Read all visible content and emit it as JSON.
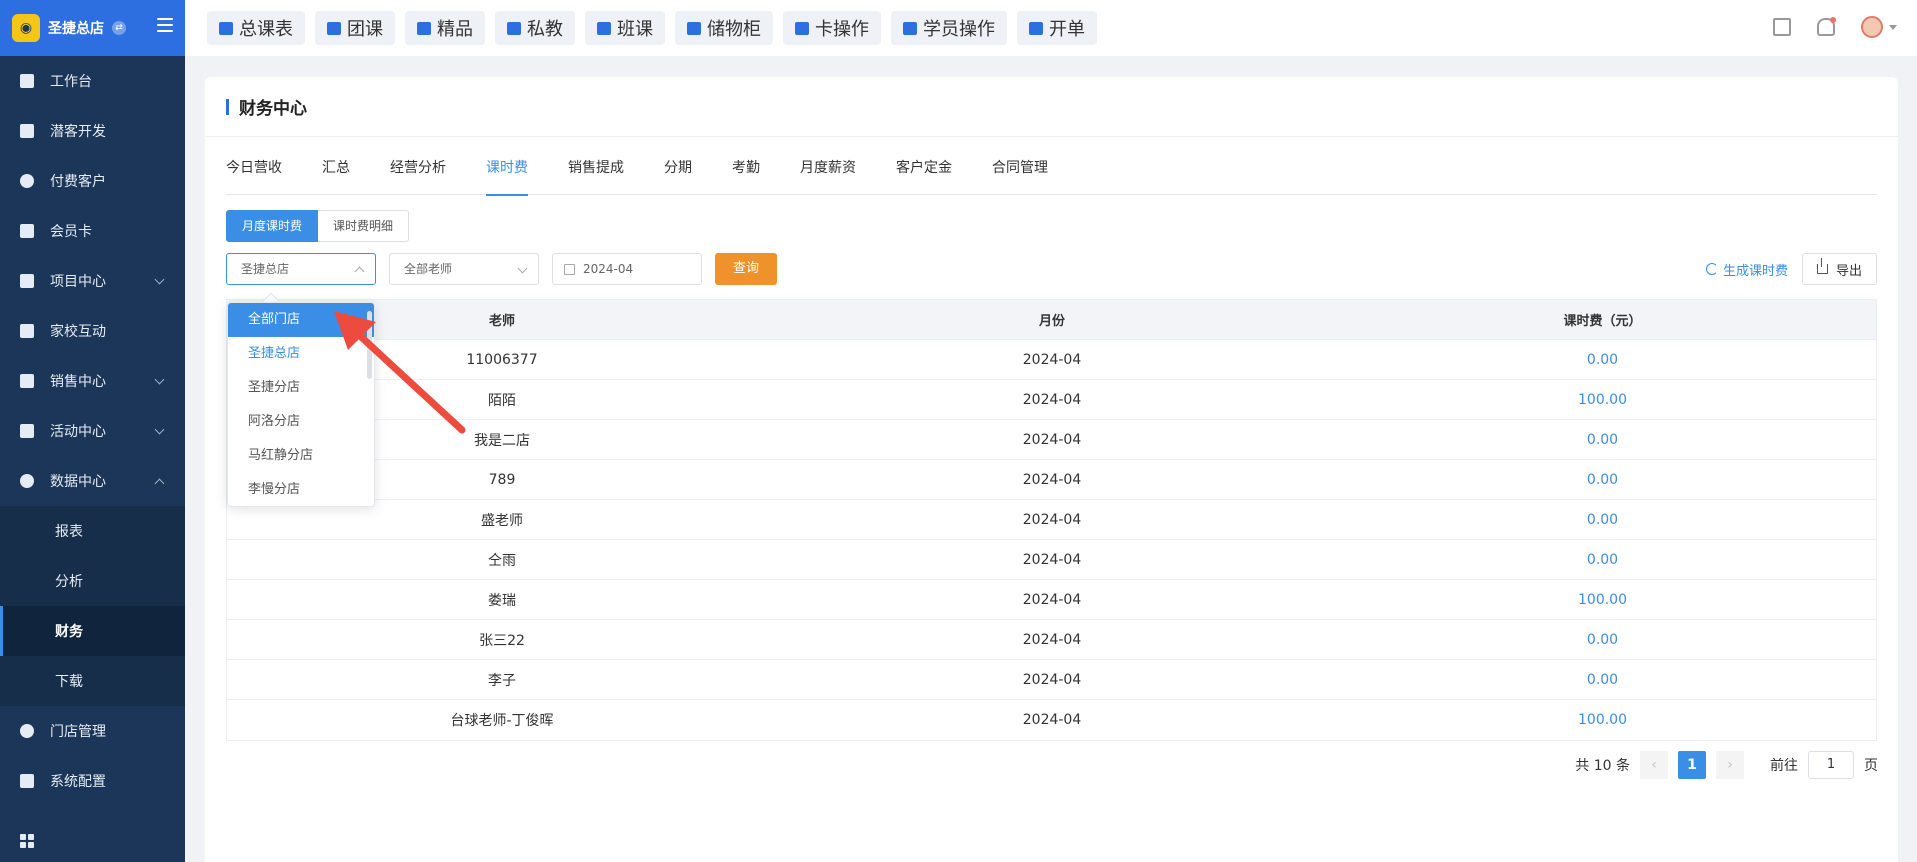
{
  "sidebar": {
    "brand": "圣捷总店",
    "menu_top": [
      {
        "label": "工作台",
        "icon": "monitor-icon"
      },
      {
        "label": "潜客开发",
        "icon": "id-card-icon"
      },
      {
        "label": "付费客户",
        "icon": "users-icon"
      },
      {
        "label": "会员卡",
        "icon": "card-icon"
      },
      {
        "label": "项目中心",
        "icon": "folder-icon"
      },
      {
        "label": "家校互动",
        "icon": "chat-icon"
      },
      {
        "label": "销售中心",
        "icon": "tag-icon"
      },
      {
        "label": "活动中心",
        "icon": "gift-icon"
      },
      {
        "label": "数据中心",
        "icon": "pie-chart-icon"
      }
    ],
    "submenu": [
      {
        "label": "报表"
      },
      {
        "label": "分析"
      },
      {
        "label": "财务"
      },
      {
        "label": "下载"
      }
    ],
    "menu_bottom": [
      {
        "label": "门店管理",
        "icon": "store-icon"
      },
      {
        "label": "系统配置",
        "icon": "settings-icon"
      }
    ]
  },
  "topbar": {
    "buttons": [
      {
        "label": "总课表",
        "icon": "book-icon"
      },
      {
        "label": "团课",
        "icon": "book-icon"
      },
      {
        "label": "精品",
        "icon": "star-icon"
      },
      {
        "label": "私教",
        "icon": "users-icon"
      },
      {
        "label": "班课",
        "icon": "board-icon"
      },
      {
        "label": "储物柜",
        "icon": "locker-icon"
      },
      {
        "label": "卡操作",
        "icon": "card-icon"
      },
      {
        "label": "学员操作",
        "icon": "user-plus-icon"
      },
      {
        "label": "开单",
        "icon": "receipt-icon"
      }
    ]
  },
  "page": {
    "title": "财务中心",
    "tabs": [
      "今日营收",
      "汇总",
      "经营分析",
      "课时费",
      "销售提成",
      "分期",
      "考勤",
      "月度薪资",
      "客户定金",
      "合同管理"
    ],
    "active_tab": "课时费",
    "segments": [
      "月度课时费",
      "课时费明细"
    ],
    "filters": {
      "store": "圣捷总店",
      "teacher": "全部老师",
      "month": "2024-04",
      "query_label": "查询"
    },
    "actions": {
      "generate_label": "生成课时费",
      "export_label": "导出"
    }
  },
  "table": {
    "columns": [
      "老师",
      "月份",
      "课时费（元）"
    ],
    "rows": [
      {
        "teacher": "11006377",
        "month": "2024-04",
        "fee": "0.00"
      },
      {
        "teacher": "陌陌",
        "month": "2024-04",
        "fee": "100.00"
      },
      {
        "teacher": "我是二店",
        "month": "2024-04",
        "fee": "0.00"
      },
      {
        "teacher": "789",
        "month": "2024-04",
        "fee": "0.00"
      },
      {
        "teacher": "盛老师",
        "month": "2024-04",
        "fee": "0.00"
      },
      {
        "teacher": "仝雨",
        "month": "2024-04",
        "fee": "0.00"
      },
      {
        "teacher": "娄瑞",
        "month": "2024-04",
        "fee": "100.00"
      },
      {
        "teacher": "张三22",
        "month": "2024-04",
        "fee": "0.00"
      },
      {
        "teacher": "李子",
        "month": "2024-04",
        "fee": "0.00"
      },
      {
        "teacher": "台球老师-丁俊晖",
        "month": "2024-04",
        "fee": "100.00"
      }
    ]
  },
  "pagination": {
    "total_label": "共 10 条",
    "current_page": "1",
    "goto_label": "前往",
    "goto_value": "1",
    "page_suffix": "页"
  },
  "dropdown": {
    "options": [
      "全部门店",
      "圣捷总店",
      "圣捷分店",
      "阿洛分店",
      "马红静分店",
      "李慢分店"
    ],
    "hovered": "全部门店",
    "selected": "圣捷总店"
  },
  "colors": {
    "sidebar_bg": "#1b3658",
    "brand_bg": "#2d6fe0",
    "accent": "#3a8ee6",
    "query_btn": "#f0922b",
    "annotation_arrow": "#ee4b3f"
  }
}
